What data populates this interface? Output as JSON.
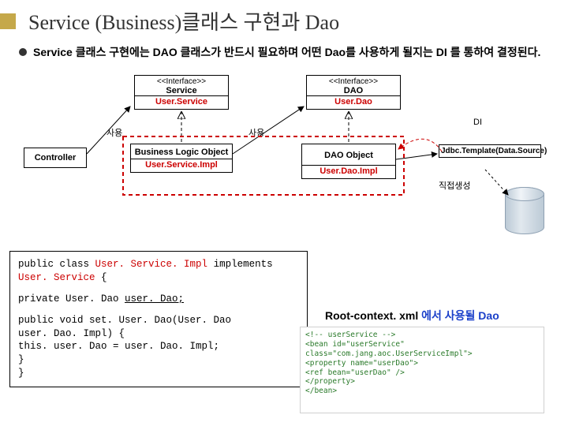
{
  "title": "Service (Business)클래스 구현과 Dao",
  "bullet": "Service 클래스 구현에는 DAO 클래스가 반드시 필요하며 어떤 Dao를 사용하게 될지는 DI 를 통하여 결정된다.",
  "diagram": {
    "iface_service": {
      "stereo": "<<Interface>>",
      "name": "Service",
      "impl": "User.Service"
    },
    "iface_dao": {
      "stereo": "<<Interface>>",
      "name": "DAO",
      "impl": "User.Dao"
    },
    "controller": "Controller",
    "blo": {
      "name": "Business Logic Object",
      "impl": "User.Service.Impl"
    },
    "dao_obj": {
      "name": "DAO Object",
      "impl": "User.Dao.Impl"
    },
    "jdbc": "Jdbc.Template(Data.Source)",
    "label_use1": "사용",
    "label_use2": "사용",
    "label_di": "DI",
    "label_direct": "직접생성"
  },
  "code": {
    "l1a": "public class ",
    "l1b": "User. Service. Impl",
    "l1c": " implements",
    "l2a": "User. Service",
    "l2b": " {",
    "l3a": "    private User. Dao  ",
    "l3b": "user. Dao;",
    "l4a": "    public void set. User. Dao(User. Dao",
    "l5a": "    user. Dao. Impl) {",
    "l6a": "            this. user. Dao =  user. Dao. Impl;",
    "l7a": "    }",
    "l8a": "}"
  },
  "root_note_a": "Root-context. xml",
  "root_note_b": " 에서 ",
  "root_note_c": "사용될 Dao",
  "xml": {
    "l1": "<!-- userService -->",
    "l2": "<bean id=\"userService\" class=\"com.jang.aoc.UserServiceImpl\">",
    "l3": "    <property name=\"userDao\">",
    "l4": "        <ref bean=\"userDao\" />",
    "l5": "    </property>",
    "l6": "</bean>"
  }
}
